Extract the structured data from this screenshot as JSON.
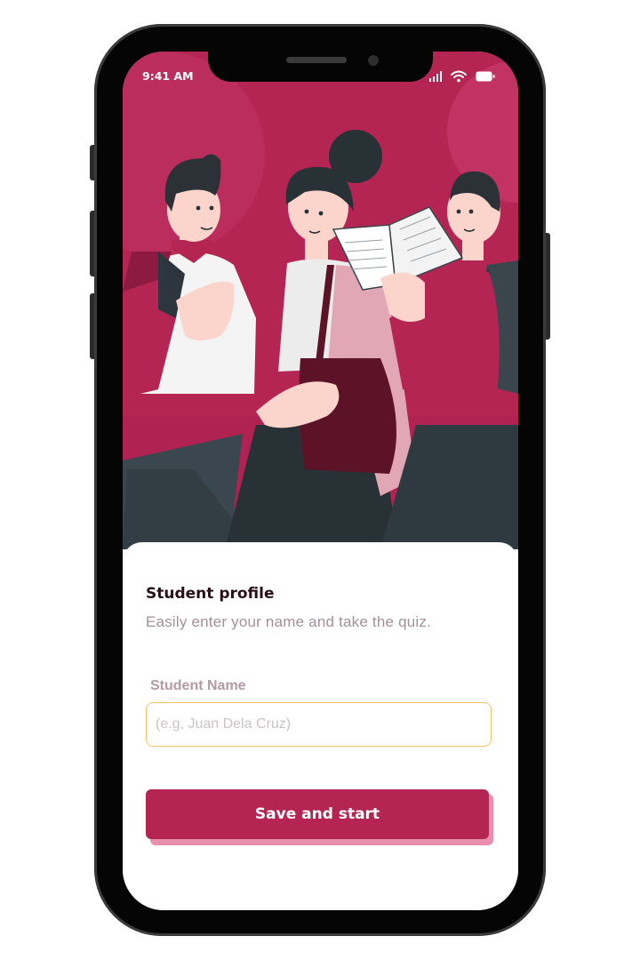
{
  "status_bar": {
    "time": "9:41 AM"
  },
  "colors": {
    "brand": "#b52554",
    "input_border": "#f2c36a",
    "button_shadow": "#e98fae"
  },
  "hero": {
    "illustration": "students-talking-illustration"
  },
  "profile": {
    "title": "Student profile",
    "subtitle": "Easily enter your name and take the quiz.",
    "name_label": "Student Name",
    "name_value": "",
    "name_placeholder": "(e.g, Juan Dela Cruz)",
    "submit_label": "Save and start"
  }
}
